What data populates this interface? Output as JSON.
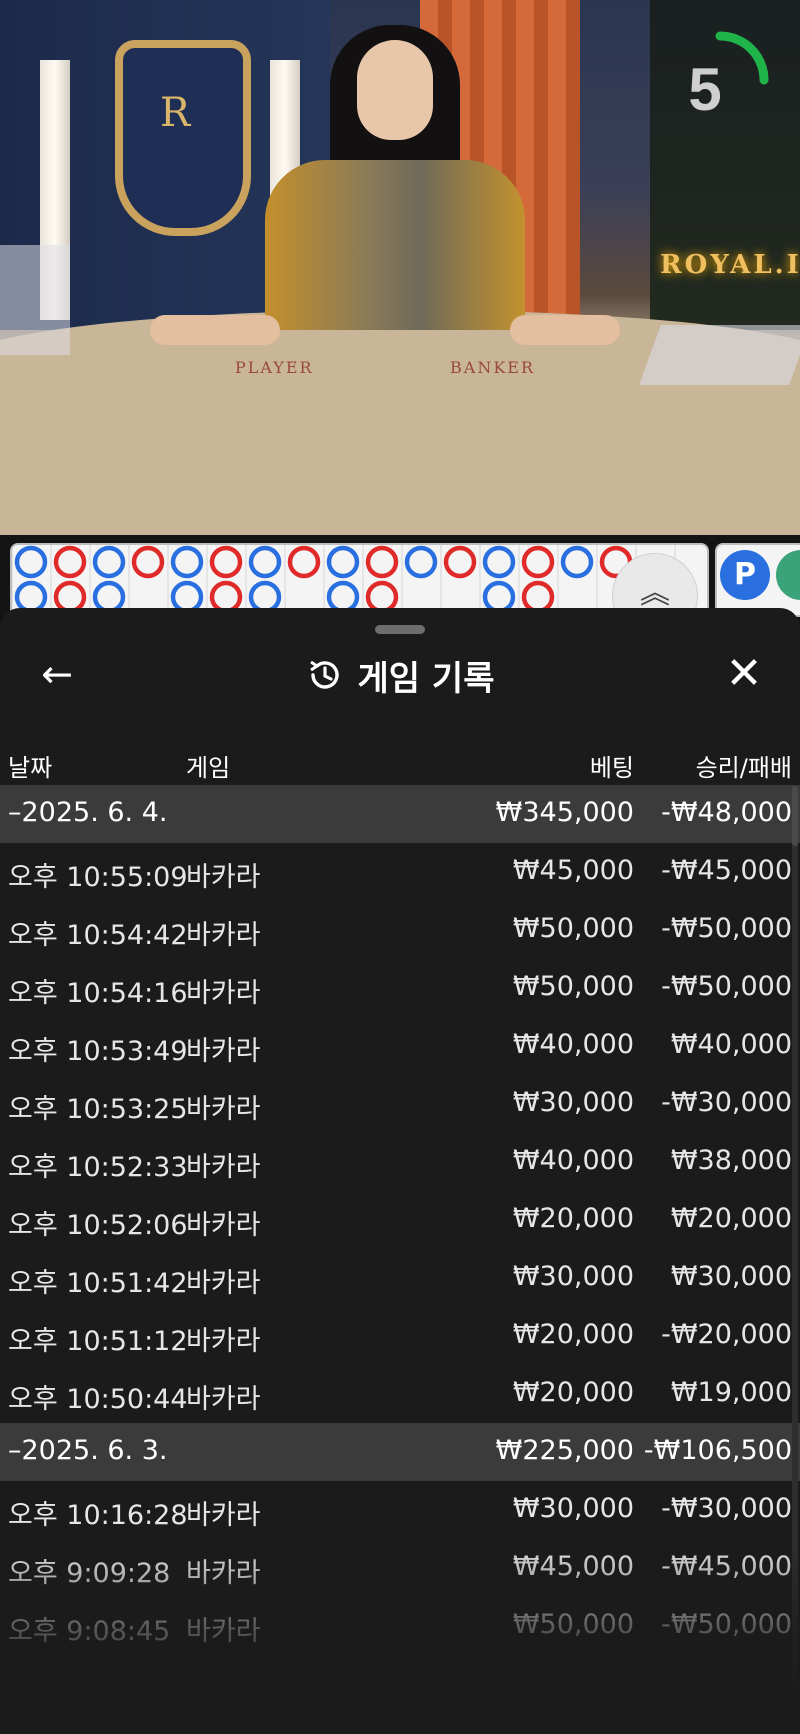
{
  "video": {
    "countdown": "5",
    "table_player_label": "PLAYER",
    "table_banker_label": "BANKER",
    "crest_letter": "R",
    "sign_text": "ROYAL.I",
    "countdown_color": "#1fb34a"
  },
  "roadmap": {
    "player_color": "#2a6fe0",
    "banker_color": "#e02a2a",
    "top_row": [
      "P",
      "B",
      "P",
      "B",
      "P",
      "B",
      "P",
      "B",
      "P",
      "B",
      "P",
      "B",
      "P",
      "B",
      "P",
      "B"
    ],
    "bottom_row": [
      "P",
      "B",
      "P",
      "",
      "P",
      "B",
      "P",
      "",
      "P",
      "B",
      "",
      "",
      "P",
      "B",
      "",
      ""
    ],
    "p_badge": "P",
    "expand_icon": "double-chevron-up-icon"
  },
  "sheet": {
    "title": "게임 기록",
    "back_icon": "arrow-left-icon",
    "history_icon": "history-icon",
    "close_icon": "close-icon",
    "columns": {
      "date": "날짜",
      "game": "게임",
      "bet": "베팅",
      "result": "승리/패배"
    },
    "groups": [
      {
        "date": "–2025. 6. 4.",
        "bet_total": "₩345,000",
        "result_total": "-₩48,000",
        "rows": [
          {
            "time": "오후 10:55:09",
            "game": "바카라",
            "bet": "₩45,000",
            "result": "-₩45,000"
          },
          {
            "time": "오후 10:54:42",
            "game": "바카라",
            "bet": "₩50,000",
            "result": "-₩50,000"
          },
          {
            "time": "오후 10:54:16",
            "game": "바카라",
            "bet": "₩50,000",
            "result": "-₩50,000"
          },
          {
            "time": "오후 10:53:49",
            "game": "바카라",
            "bet": "₩40,000",
            "result": "₩40,000"
          },
          {
            "time": "오후 10:53:25",
            "game": "바카라",
            "bet": "₩30,000",
            "result": "-₩30,000"
          },
          {
            "time": "오후 10:52:33",
            "game": "바카라",
            "bet": "₩40,000",
            "result": "₩38,000"
          },
          {
            "time": "오후 10:52:06",
            "game": "바카라",
            "bet": "₩20,000",
            "result": "₩20,000"
          },
          {
            "time": "오후 10:51:42",
            "game": "바카라",
            "bet": "₩30,000",
            "result": "₩30,000"
          },
          {
            "time": "오후 10:51:12",
            "game": "바카라",
            "bet": "₩20,000",
            "result": "-₩20,000"
          },
          {
            "time": "오후 10:50:44",
            "game": "바카라",
            "bet": "₩20,000",
            "result": "₩19,000"
          }
        ]
      },
      {
        "date": "–2025. 6. 3.",
        "bet_total": "₩225,000",
        "result_total": "-₩106,500",
        "rows": [
          {
            "time": "오후 10:16:28",
            "game": "바카라",
            "bet": "₩30,000",
            "result": "-₩30,000"
          },
          {
            "time": "오후 9:09:28",
            "game": "바카라",
            "bet": "₩45,000",
            "result": "-₩45,000"
          },
          {
            "time": "오후 9:08:45",
            "game": "바카라",
            "bet": "₩50,000",
            "result": "-₩50,000"
          }
        ]
      }
    ]
  }
}
